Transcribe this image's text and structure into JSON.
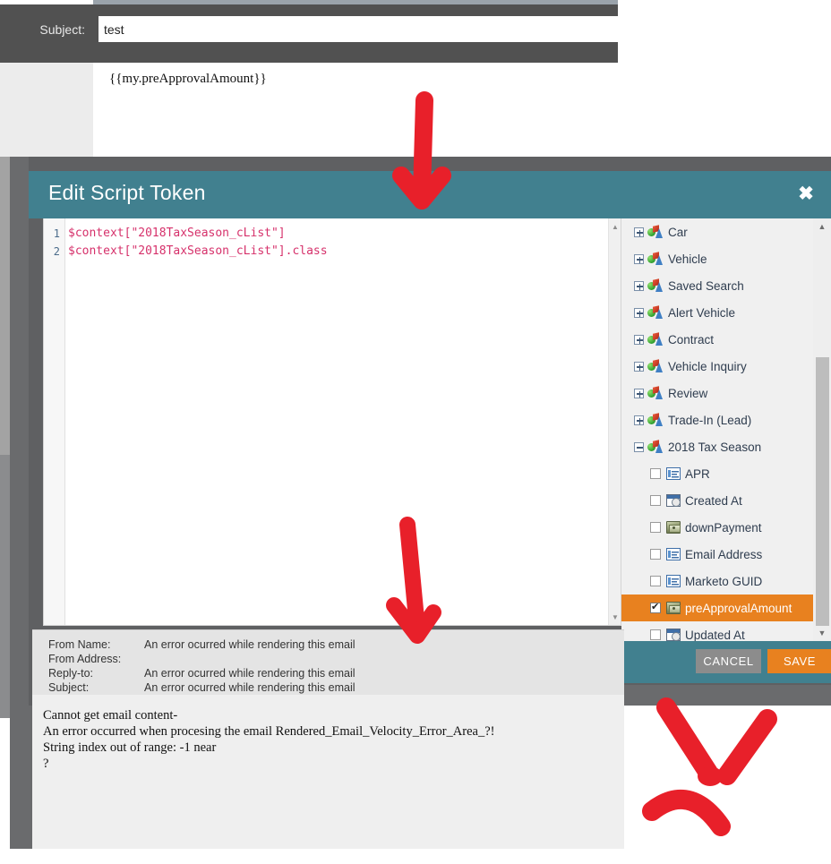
{
  "background": {
    "subject_label": "Subject:",
    "subject_value": "test",
    "body_token": "{{my.preApprovalAmount}}"
  },
  "dialog": {
    "title": "Edit Script Token",
    "close_icon": "close-x-icon",
    "code": {
      "line_numbers": [
        "1",
        "2"
      ],
      "lines": [
        "$context[\"2018TaxSeason_cList\"]",
        "$context[\"2018TaxSeason_cList\"].class"
      ],
      "scroll_up_icon": "▲",
      "scroll_down_icon": "▼"
    },
    "tree": {
      "scroll_up_icon": "▲",
      "scroll_down_icon": "▼",
      "objects": [
        {
          "label": "Car",
          "expander": "plus",
          "icon": "object-icon",
          "level": 0
        },
        {
          "label": "Vehicle",
          "expander": "plus",
          "icon": "object-icon",
          "level": 0
        },
        {
          "label": "Saved Search",
          "expander": "plus",
          "icon": "object-icon",
          "level": 0
        },
        {
          "label": "Alert Vehicle",
          "expander": "plus",
          "icon": "object-icon",
          "level": 0
        },
        {
          "label": "Contract",
          "expander": "plus",
          "icon": "object-icon",
          "level": 0
        },
        {
          "label": "Vehicle Inquiry",
          "expander": "plus",
          "icon": "object-icon",
          "level": 0
        },
        {
          "label": "Review",
          "expander": "plus",
          "icon": "object-icon",
          "level": 0
        },
        {
          "label": "Trade-In (Lead)",
          "expander": "plus",
          "icon": "object-icon",
          "level": 0
        },
        {
          "label": "2018 Tax Season",
          "expander": "minus",
          "icon": "object-icon",
          "level": 0
        }
      ],
      "fields": [
        {
          "label": "APR",
          "checked": false,
          "icon": "text-field-icon",
          "icon_class": "text"
        },
        {
          "label": "Created At",
          "checked": false,
          "icon": "date-field-icon",
          "icon_class": "date"
        },
        {
          "label": "downPayment",
          "checked": false,
          "icon": "money-field-icon",
          "icon_class": "money"
        },
        {
          "label": "Email Address",
          "checked": false,
          "icon": "text-field-icon",
          "icon_class": "text"
        },
        {
          "label": "Marketo GUID",
          "checked": false,
          "icon": "text-field-icon",
          "icon_class": "text"
        },
        {
          "label": "preApprovalAmount",
          "checked": true,
          "icon": "money-field-icon",
          "icon_class": "money"
        },
        {
          "label": "Updated At",
          "checked": false,
          "icon": "date-field-icon",
          "icon_class": "date"
        }
      ],
      "selected_field": "preApprovalAmount"
    },
    "footer": {
      "cancel_label": "CANCEL",
      "save_label": "SAVE"
    }
  },
  "preview": {
    "header_rows": [
      {
        "label": "From Name:",
        "value": "An error ocurred while rendering this email"
      },
      {
        "label": "From Address:",
        "value": ""
      },
      {
        "label": "Reply-to:",
        "value": "An error ocurred while rendering this email"
      },
      {
        "label": "Subject:",
        "value": "An error ocurred while rendering this email"
      }
    ],
    "body_lines": [
      "Cannot get email content-",
      "An error occurred when procesing the email Rendered_Email_Velocity_Error_Area_?!",
      "",
      "String index out of range: -1 near",
      "",
      "?"
    ]
  },
  "annotations": {
    "arrow_top": "red-arrow-down-pointing-at-dialog-title",
    "arrow_middle": "red-arrow-down-pointing-at-preview",
    "sad_face": "red-hand-drawn-sad-face"
  },
  "colors": {
    "teal": "#41808f",
    "orange": "#e8811f",
    "gray_button": "#8c8c8c",
    "code_pink": "#d6316b",
    "overlay": "#5f6062",
    "annotation_red": "#e8202a"
  }
}
